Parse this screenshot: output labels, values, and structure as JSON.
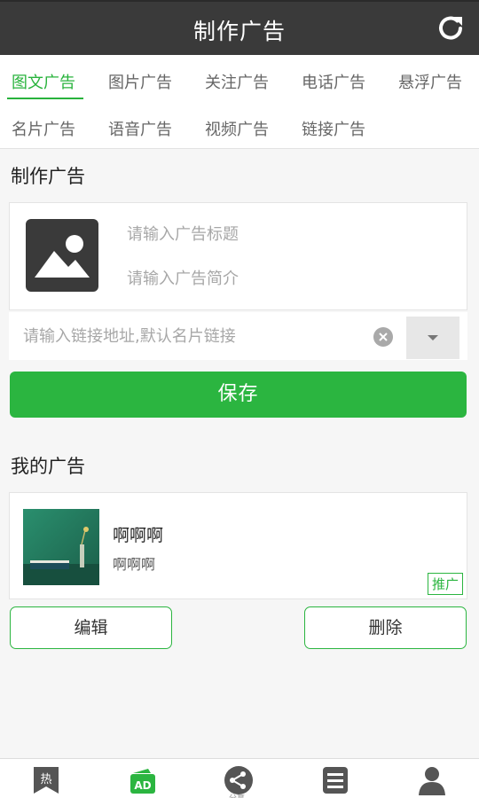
{
  "header": {
    "title": "制作广告",
    "refresh_icon": "refresh-icon"
  },
  "tabs": [
    {
      "label": "图文广告",
      "active": true
    },
    {
      "label": "图片广告"
    },
    {
      "label": "关注广告"
    },
    {
      "label": "电话广告"
    },
    {
      "label": "悬浮广告"
    },
    {
      "label": "名片广告"
    },
    {
      "label": "语音广告"
    },
    {
      "label": "视频广告"
    },
    {
      "label": "链接广告"
    }
  ],
  "create": {
    "section_title": "制作广告",
    "image_icon": "image-placeholder-icon",
    "title_placeholder": "请输入广告标题",
    "intro_placeholder": "请输入广告简介",
    "link_placeholder": "请输入链接地址,默认名片链接",
    "save_label": "保存"
  },
  "mine": {
    "section_title": "我的广告",
    "ad": {
      "title": "啊啊啊",
      "desc": "啊啊啊",
      "badge": "推广"
    },
    "edit_label": "编辑",
    "delete_label": "删除"
  },
  "bottom_nav": {
    "items": [
      "hot-icon",
      "ad-icon",
      "share-icon",
      "list-icon",
      "profile-icon"
    ],
    "active": "ad-icon",
    "hot_glyph": "热",
    "ad_glyph": "AD",
    "caption": "分享"
  },
  "colors": {
    "accent": "#2bb540",
    "header_bg": "#3a3a3a",
    "icon_gray": "#555555"
  }
}
